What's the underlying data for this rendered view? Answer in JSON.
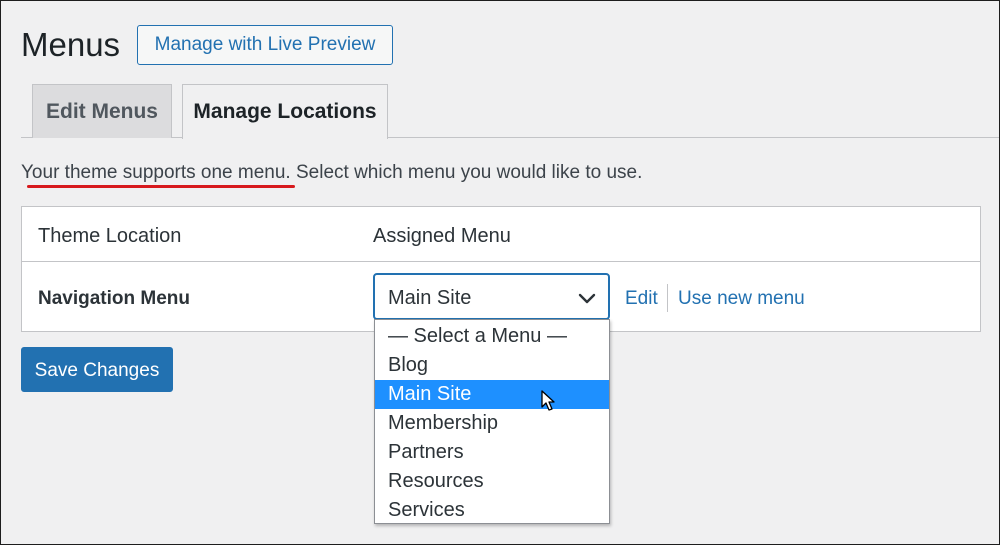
{
  "header": {
    "title": "Menus",
    "live_preview_label": "Manage with Live Preview"
  },
  "tabs": [
    {
      "label": "Edit Menus"
    },
    {
      "label": "Manage Locations"
    }
  ],
  "intro": {
    "underlined": "Your theme supports one menu",
    "rest": ". Select which menu you would like to use."
  },
  "table": {
    "col_location": "Theme Location",
    "col_assigned": "Assigned Menu",
    "row_label": "Navigation Menu",
    "selected_value": "Main Site",
    "edit_link": "Edit",
    "new_menu_link": "Use new menu"
  },
  "dropdown": {
    "options": [
      "— Select a Menu —",
      "Blog",
      "Main Site",
      "Membership",
      "Partners",
      "Resources",
      "Services"
    ],
    "highlighted_index": 2
  },
  "save_label": "Save Changes",
  "colors": {
    "accent": "#2271b1",
    "highlight": "#1e90ff",
    "underline": "#d7191d"
  }
}
